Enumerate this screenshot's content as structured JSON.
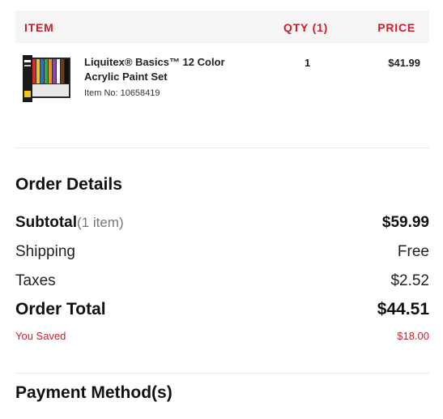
{
  "table_header": {
    "item": "ITEM",
    "qty": "QTY (1)",
    "price": "PRICE"
  },
  "product": {
    "name": "Liquitex® Basics™ 12 Color Acrylic Paint Set",
    "item_no_label": "Item No:",
    "item_no": "10658419",
    "qty": "1",
    "price": "$41.99",
    "thumbnail_icon": "paint-set-box-image"
  },
  "order_details": {
    "title": "Order Details",
    "subtotal_label": "Subtotal",
    "subtotal_note": "(1 item)",
    "subtotal_value": "$59.99",
    "shipping_label": "Shipping",
    "shipping_value": "Free",
    "taxes_label": "Taxes",
    "taxes_value": "$2.52",
    "total_label": "Order Total",
    "total_value": "$44.51",
    "saved_label": "You Saved",
    "saved_value": "$18.00"
  },
  "payment": {
    "title": "Payment Method(s)"
  },
  "colors": {
    "accent": "#c8202f",
    "header_bg": "#f5f5f5",
    "divider": "#e6e6e6"
  }
}
